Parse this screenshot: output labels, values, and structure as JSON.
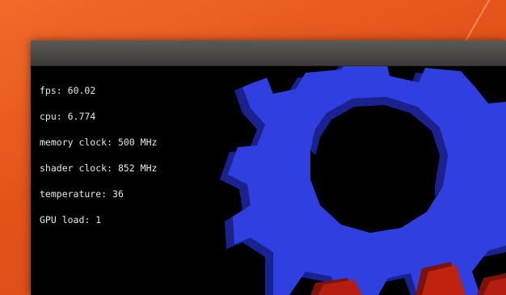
{
  "overlay": {
    "stats": [
      {
        "label": "fps:",
        "value": "60.02"
      },
      {
        "label": "cpu:",
        "value": "6.774"
      },
      {
        "label": "memory clock:",
        "value": "500 MHz"
      },
      {
        "label": "shader clock:",
        "value": "852 MHz"
      },
      {
        "label": "temperature:",
        "value": "36"
      },
      {
        "label": "GPU load:",
        "value": "1"
      }
    ]
  },
  "colors": {
    "desktop": "#e35219",
    "titlebar": "#4a4946",
    "gear_blue": "#2f3fe0",
    "gear_blue_dark": "#1a2290",
    "gear_red": "#b31d10",
    "overlay_text": "#e8e8e8"
  },
  "icons": {
    "gear_blue": "gear-icon",
    "gear_red": "gear-icon"
  }
}
